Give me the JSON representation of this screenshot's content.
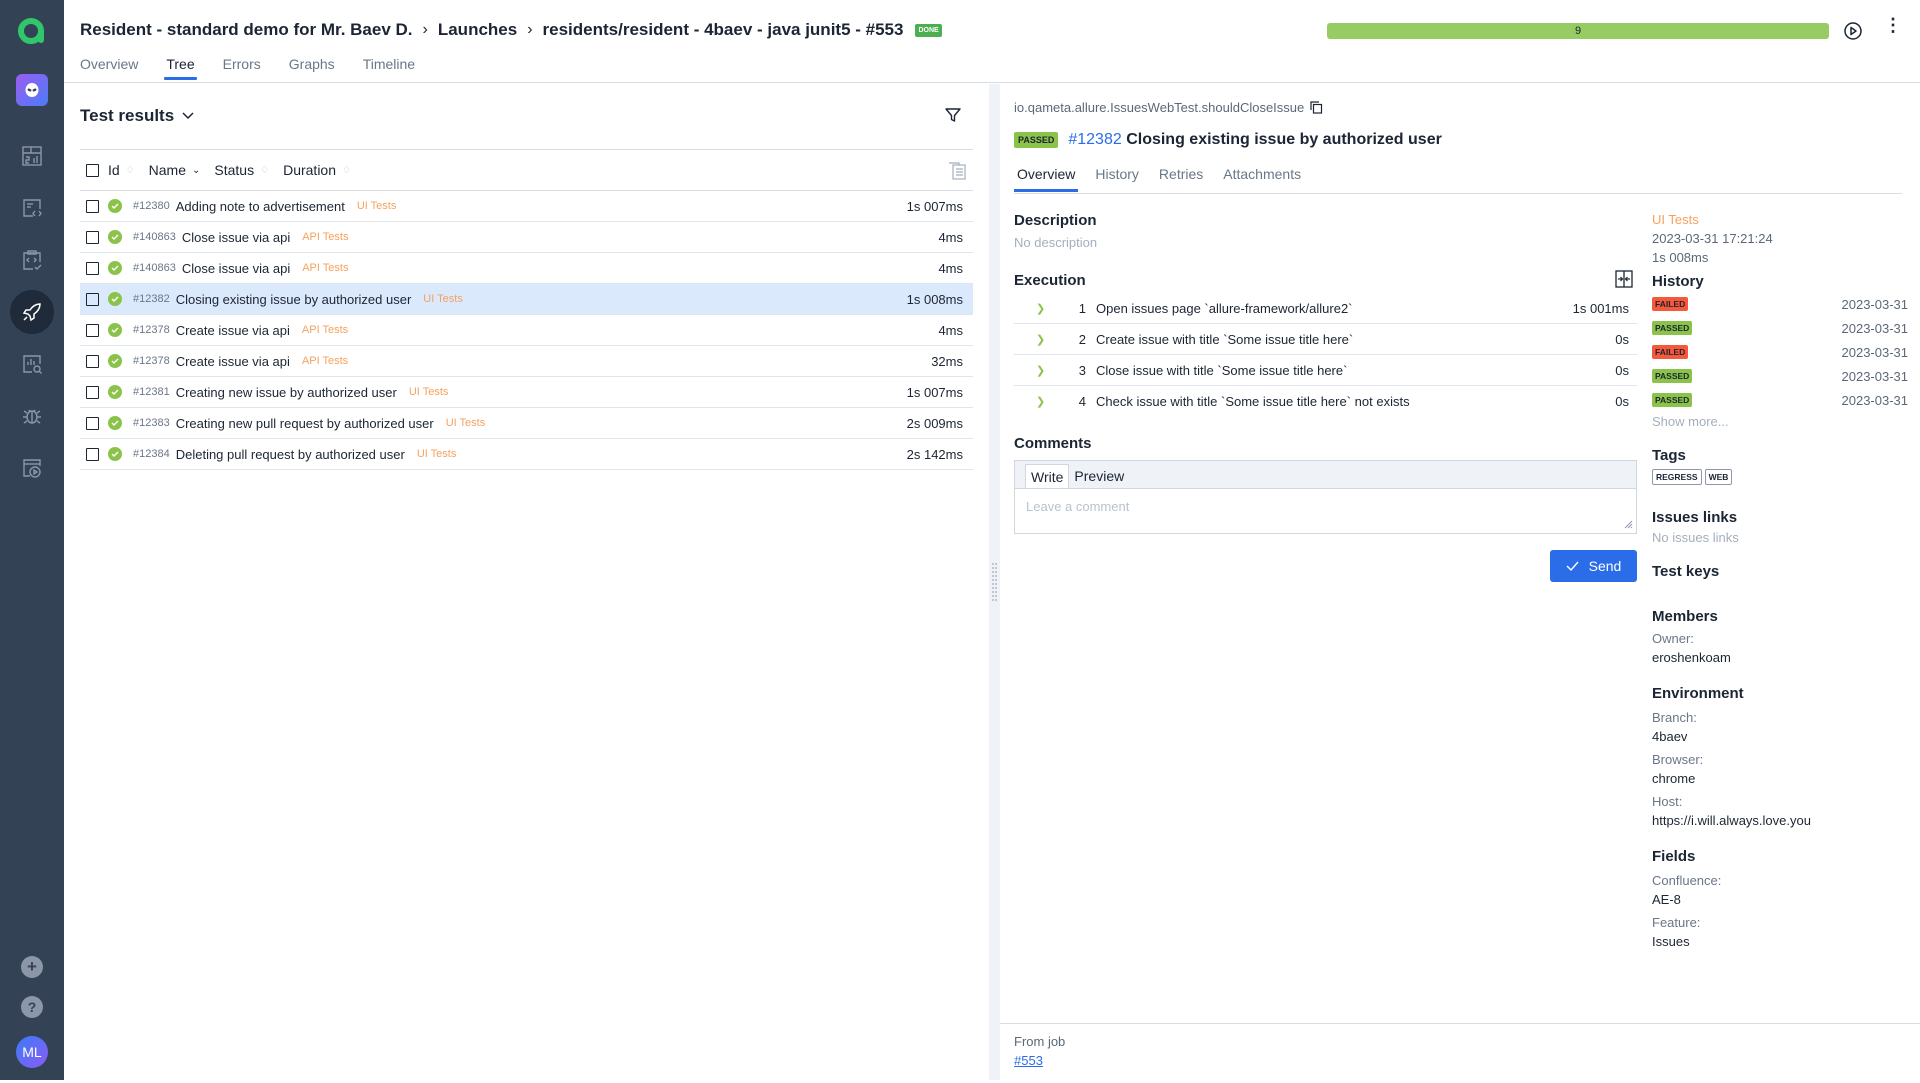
{
  "sidebar": {
    "avatar_initials": "ML",
    "icons": [
      "dashboard-icon",
      "test-cases-icon",
      "test-plans-icon",
      "launches-icon",
      "analytics-icon",
      "defects-icon",
      "jobs-icon"
    ]
  },
  "header": {
    "breadcrumb": [
      "Resident - standard demo for Mr. Baev D.",
      "Launches",
      "residents/resident - 4baev - java junit5 - #553"
    ],
    "status_badge": "DONE",
    "tabs": [
      "Overview",
      "Tree",
      "Errors",
      "Graphs",
      "Timeline"
    ],
    "active_tab": "Tree",
    "progress": {
      "passed": 9,
      "label": "9",
      "passed_fraction": 1.0,
      "color": "#97cc64"
    }
  },
  "left": {
    "title": "Test results",
    "columns": [
      "Id",
      "Name",
      "Status",
      "Duration"
    ],
    "rows": [
      {
        "id": "#12380",
        "name": "Adding note to advertisement",
        "tag": "UI Tests",
        "duration": "1s 007ms",
        "status": "passed"
      },
      {
        "id": "#140863",
        "name": "Close issue via api",
        "tag": "API Tests",
        "duration": "4ms",
        "status": "passed"
      },
      {
        "id": "#140863",
        "name": "Close issue via api",
        "tag": "API Tests",
        "duration": "4ms",
        "status": "passed"
      },
      {
        "id": "#12382",
        "name": "Closing existing issue by authorized user",
        "tag": "UI Tests",
        "duration": "1s 008ms",
        "status": "passed",
        "selected": true
      },
      {
        "id": "#12378",
        "name": "Create issue via api",
        "tag": "API Tests",
        "duration": "4ms",
        "status": "passed"
      },
      {
        "id": "#12378",
        "name": "Create issue via api",
        "tag": "API Tests",
        "duration": "32ms",
        "status": "passed"
      },
      {
        "id": "#12381",
        "name": "Creating new issue by authorized user",
        "tag": "UI Tests",
        "duration": "1s 007ms",
        "status": "passed"
      },
      {
        "id": "#12383",
        "name": "Creating new pull request by authorized user",
        "tag": "UI Tests",
        "duration": "2s 009ms",
        "status": "passed"
      },
      {
        "id": "#12384",
        "name": "Deleting pull request by authorized user",
        "tag": "UI Tests",
        "duration": "2s 142ms",
        "status": "passed"
      }
    ]
  },
  "detail": {
    "full_name": "io.qameta.allure.IssuesWebTest.shouldCloseIssue",
    "status": "PASSED",
    "id": "#12382",
    "title": "Closing existing issue by authorized user",
    "tabs": [
      "Overview",
      "History",
      "Retries",
      "Attachments"
    ],
    "active_tab": "Overview",
    "description_heading": "Description",
    "description": "No description",
    "execution_heading": "Execution",
    "steps": [
      {
        "n": "1",
        "text": "Open issues page `allure-framework/allure2`",
        "duration": "1s 001ms"
      },
      {
        "n": "2",
        "text": "Create issue with title `Some issue title here`",
        "duration": "0s"
      },
      {
        "n": "3",
        "text": "Close issue with title `Some issue title here`",
        "duration": "0s"
      },
      {
        "n": "4",
        "text": "Check issue with title `Some issue title here` not exists",
        "duration": "0s"
      }
    ],
    "comments_heading": "Comments",
    "comment_tabs": [
      "Write",
      "Preview"
    ],
    "comment_placeholder": "Leave a comment",
    "send_label": "Send",
    "side": {
      "layer": "UI Tests",
      "started": "2023-03-31 17:21:24",
      "duration": "1s 008ms",
      "history_heading": "History",
      "history": [
        {
          "status": "FAILED",
          "date": "2023-03-31"
        },
        {
          "status": "PASSED",
          "date": "2023-03-31"
        },
        {
          "status": "FAILED",
          "date": "2023-03-31"
        },
        {
          "status": "PASSED",
          "date": "2023-03-31"
        },
        {
          "status": "PASSED",
          "date": "2023-03-31"
        }
      ],
      "show_more": "Show more...",
      "tags_heading": "Tags",
      "tags": [
        "REGRESS",
        "WEB"
      ],
      "issues_heading": "Issues links",
      "issues_empty": "No issues links",
      "keys_heading": "Test keys",
      "members_heading": "Members",
      "owner_label": "Owner:",
      "owner": "eroshenkoam",
      "env_heading": "Environment",
      "env": [
        {
          "label": "Branch:",
          "value": "4baev"
        },
        {
          "label": "Browser:",
          "value": "chrome"
        },
        {
          "label": "Host:",
          "value": "https://i.will.always.love.you"
        }
      ],
      "fields_heading": "Fields",
      "fields": [
        {
          "label": "Confluence:",
          "value": "AE-8"
        },
        {
          "label": "Feature:",
          "value": "Issues"
        }
      ]
    },
    "footer": {
      "label": "From job",
      "link": "#553"
    }
  }
}
